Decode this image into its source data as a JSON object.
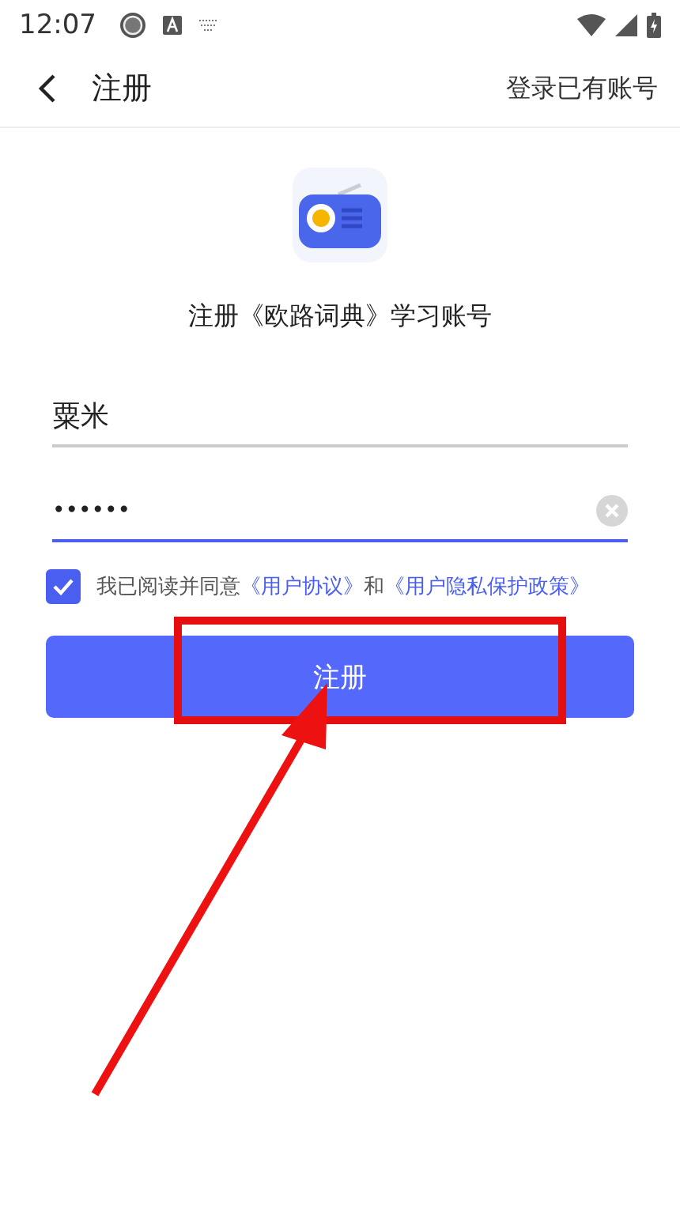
{
  "status_bar": {
    "time": "12:07"
  },
  "nav_bar": {
    "title": "注册",
    "action": "登录已有账号"
  },
  "header": {
    "title": "注册《欧路词典》学习账号"
  },
  "fields": [
    {
      "kind": "text",
      "value": "粟米",
      "focused": false,
      "clearable": false
    },
    {
      "kind": "password",
      "value": "••••••",
      "focused": true,
      "clearable": true
    }
  ],
  "agreement": {
    "checked": true,
    "prefix": "我已阅读并同意",
    "link_1": "《用户协议》",
    "joiner": "和",
    "link_2": "《用户隐私保护政策》"
  },
  "button": {
    "label": "注册"
  },
  "annotation": {
    "highlight": true,
    "arrow": true
  }
}
